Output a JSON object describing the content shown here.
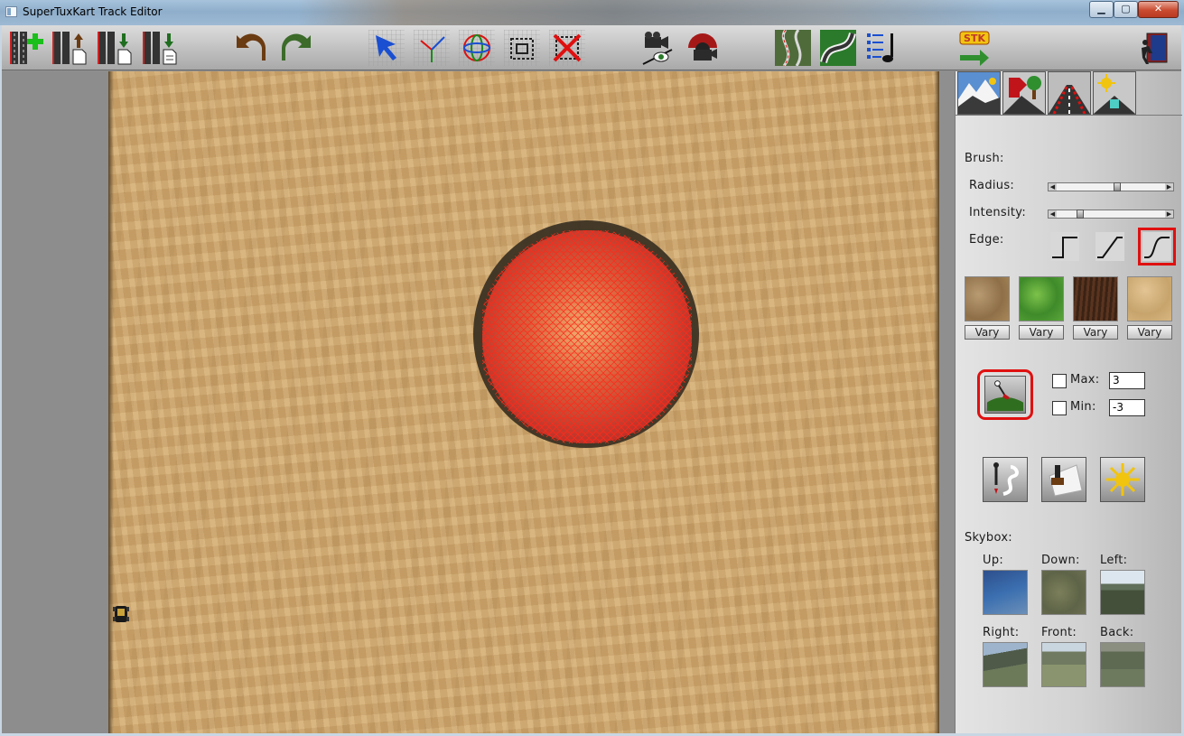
{
  "window": {
    "title": "SuperTuxKart Track Editor",
    "controls": {
      "minimize": "▁",
      "maximize": "▢",
      "close": "✕"
    }
  },
  "toolbar": {
    "items": [
      {
        "name": "new-track-icon"
      },
      {
        "name": "open-track-icon"
      },
      {
        "name": "save-track-icon"
      },
      {
        "name": "save-as-track-icon"
      },
      {
        "name": "undo-icon"
      },
      {
        "name": "redo-icon"
      },
      {
        "name": "select-icon"
      },
      {
        "name": "move-icon"
      },
      {
        "name": "rotate-icon"
      },
      {
        "name": "scale-icon"
      },
      {
        "name": "delete-icon"
      },
      {
        "name": "camera-icon"
      },
      {
        "name": "camera-restore-icon"
      },
      {
        "name": "road-icon"
      },
      {
        "name": "road-wide-icon"
      },
      {
        "name": "music-icon"
      },
      {
        "name": "stk-test-icon"
      },
      {
        "name": "exit-icon"
      }
    ]
  },
  "right_panel": {
    "tabs": [
      "terrain-tab",
      "objects-tab",
      "road-tab",
      "environment-tab"
    ],
    "brush": {
      "label": "Brush:",
      "radius_label": "Radius:",
      "radius_value": 0.57,
      "intensity_label": "Intensity:",
      "intensity_value": 0.2,
      "edge_label": "Edge:",
      "edge_options": [
        "hard",
        "linear",
        "smooth"
      ],
      "edge_selected": "smooth"
    },
    "textures": {
      "items": [
        "dirt",
        "grass",
        "dark-soil",
        "sand"
      ],
      "vary_label": "Vary"
    },
    "height_tool": {
      "max_label": "Max:",
      "max_value": "3",
      "min_label": "Min:",
      "min_value": "-3"
    },
    "skybox": {
      "label": "Skybox:",
      "up": "Up:",
      "down": "Down:",
      "left": "Left:",
      "right": "Right:",
      "front": "Front:",
      "back": "Back:"
    }
  },
  "colors": {
    "accent_red": "#e01010",
    "terrain_sand": "#cfa76e",
    "hill_red": "#c0342a"
  }
}
